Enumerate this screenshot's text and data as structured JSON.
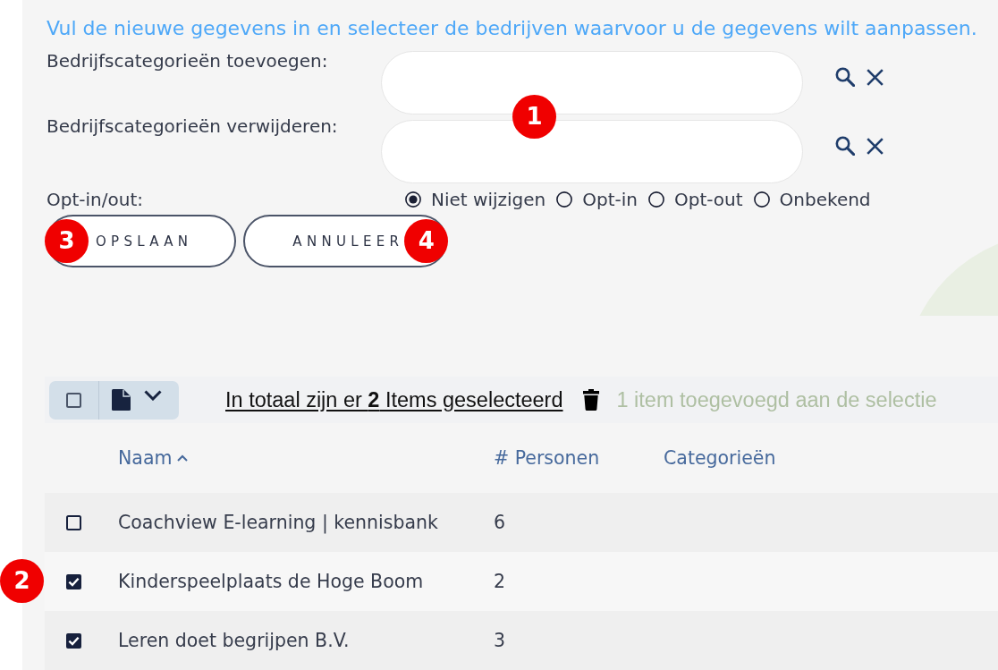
{
  "form": {
    "instruction": "Vul de nieuwe gegevens in en selecteer de bedrijven waarvoor u de gegevens wilt aanpassen.",
    "callout": "1",
    "fields": [
      {
        "label": "Bedrijfscategorieën toevoegen:"
      },
      {
        "label": "Bedrijfscategorieën verwijderen:"
      }
    ],
    "opt_in_out": {
      "label": "Opt-in/out:",
      "options": [
        {
          "label": "Niet wijzigen",
          "selected": true
        },
        {
          "label": "Opt-in",
          "selected": false
        },
        {
          "label": "Opt-out",
          "selected": false
        },
        {
          "label": "Onbekend",
          "selected": false
        }
      ]
    },
    "buttons": [
      {
        "label": "OPSLAAN",
        "callout": "3"
      },
      {
        "label": "ANNULEER",
        "callout": "4"
      }
    ]
  },
  "toolbar": {
    "select_all_checked": false,
    "selection_summary": "In totaal zijn er **2** Items geselecteerd",
    "notification": "1 item toegevoegd aan de selectie"
  },
  "table": {
    "columns": [
      {
        "label": "Naam",
        "sorted": true
      },
      {
        "label": "# Personen",
        "sorted": false
      },
      {
        "label": "Categorieën",
        "sorted": false
      }
    ],
    "rows": [
      {
        "checked": false,
        "name": "Coachview E-learning | kennisbank",
        "persons": "6"
      },
      {
        "checked": true,
        "name": "Kinderspeelplaats de Hoge Boom",
        "persons": "2",
        "callout": "2"
      },
      {
        "checked": true,
        "name": "Leren doet begrijpen B.V.",
        "persons": "3"
      }
    ]
  }
}
